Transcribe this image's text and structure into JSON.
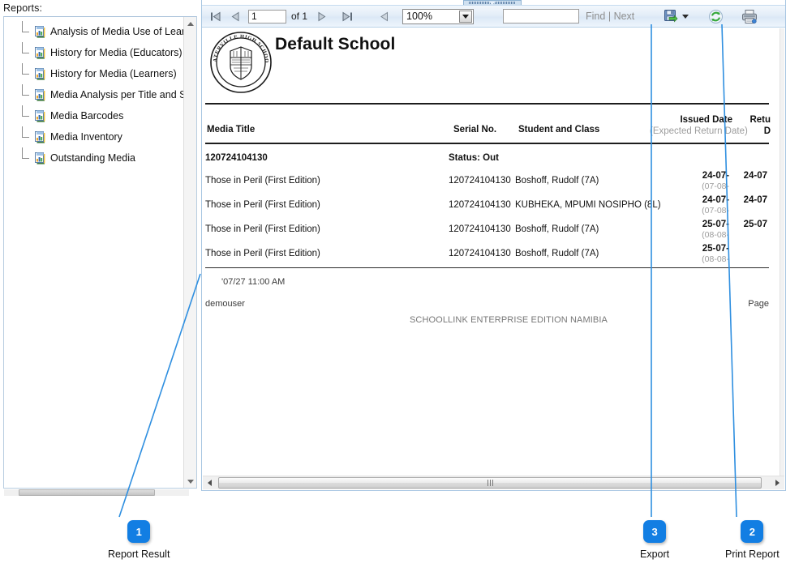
{
  "sidebar": {
    "title": "Reports:",
    "items": [
      {
        "label": "Analysis of Media Use of Learners",
        "icon": "report-document-icon"
      },
      {
        "label": "History for Media (Educators)",
        "icon": "report-document-icon"
      },
      {
        "label": "History for Media (Learners)",
        "icon": "report-document-icon"
      },
      {
        "label": "Media Analysis per Title and Status",
        "icon": "report-document-icon"
      },
      {
        "label": "Media Barcodes",
        "icon": "report-document-icon"
      },
      {
        "label": "Media Inventory",
        "icon": "report-document-icon"
      },
      {
        "label": "Outstanding Media",
        "icon": "report-document-icon"
      }
    ]
  },
  "toolbar": {
    "first_page_icon": "first-page-icon",
    "prev_page_icon": "previous-page-icon",
    "next_page_icon": "next-page-icon",
    "last_page_icon": "last-page-icon",
    "back_icon": "back-arrow-icon",
    "page_value": "1",
    "page_of": "of 1",
    "zoom_value": "100%",
    "zoom_dropdown_icon": "chevron-down-icon",
    "find_value": "",
    "find_label": "Find",
    "find_separator": "|",
    "next_label": "Next",
    "export_icon": "export-save-icon",
    "export_dropdown_icon": "chevron-down-icon",
    "refresh_icon": "refresh-icon",
    "print_icon": "printer-icon"
  },
  "report": {
    "school_name": "Default School",
    "logo_text": "WATERVILLE HIGH SCHOOL",
    "columns": {
      "media_title": "Media Title",
      "serial_no": "Serial No.",
      "student_and_class": "Student and Class",
      "issued_date": "Issued Date",
      "issued_date_sub": "(Expected Return Date)",
      "return_date_l1": "Retu",
      "return_date_l2": "D"
    },
    "group": {
      "barcode": "120724104130",
      "status": "Status: Out"
    },
    "rows": [
      {
        "media_title": "Those in Peril (First Edition)",
        "serial_no": "120724104130",
        "student_and_class": "Boshoff, Rudolf (7A)",
        "issued_date": "24-07-",
        "expected_return_date": "(07-08-",
        "return_date": "24-07"
      },
      {
        "media_title": "Those in Peril (First Edition)",
        "serial_no": "120724104130",
        "student_and_class": "KUBHEKA, MPUMI NOSIPHO (8L)",
        "issued_date": "24-07-",
        "expected_return_date": "(07-08-",
        "return_date": "24-07"
      },
      {
        "media_title": "Those in Peril (First Edition)",
        "serial_no": "120724104130",
        "student_and_class": "Boshoff, Rudolf (7A)",
        "issued_date": "25-07-",
        "expected_return_date": "(08-08-",
        "return_date": "25-07"
      },
      {
        "media_title": "Those in Peril (First Edition)",
        "serial_no": "120724104130",
        "student_and_class": "Boshoff, Rudolf (7A)",
        "issued_date": "25-07-",
        "expected_return_date": "(08-08-",
        "return_date": ""
      }
    ],
    "footer": {
      "timestamp": "'07/27 11:00 AM",
      "user": "demouser",
      "system": "SCHOOLLINK ENTERPRISE EDITION NAMIBIA",
      "page": "Page"
    }
  },
  "callouts": [
    {
      "number": "1",
      "label": "Report Result"
    },
    {
      "number": "3",
      "label": "Export"
    },
    {
      "number": "2",
      "label": "Print Report"
    }
  ],
  "colors": {
    "accent": "#127ee3",
    "panel_border": "#a8c6e2",
    "toolbar_bg": "#e3edf8",
    "muted_text": "#9c9c9c"
  }
}
